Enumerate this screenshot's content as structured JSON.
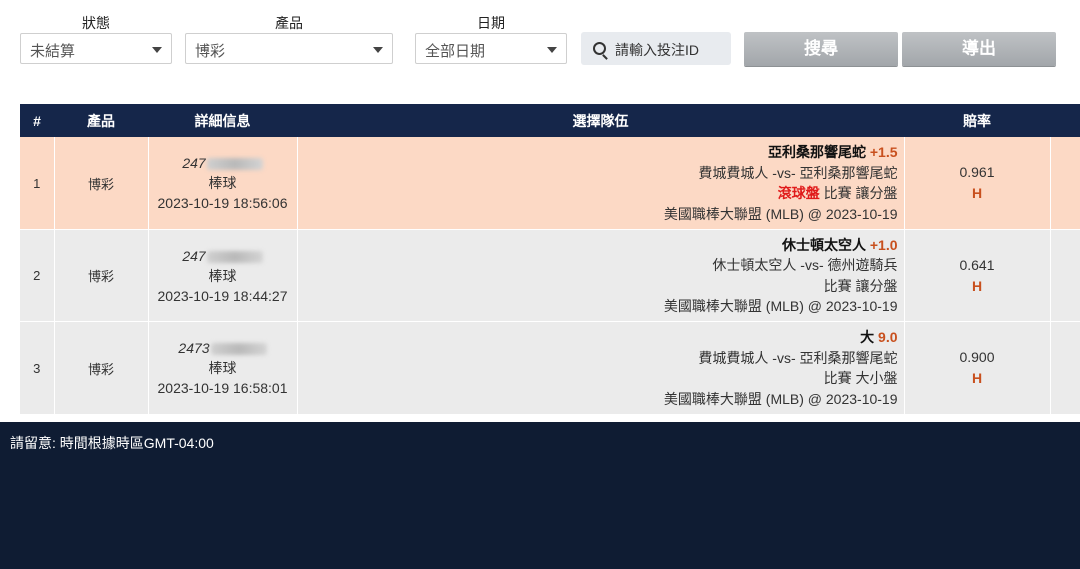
{
  "filters": {
    "status": {
      "label": "狀態",
      "value": "未結算"
    },
    "product": {
      "label": "產品",
      "value": "博彩"
    },
    "date": {
      "label": "日期",
      "value": "全部日期"
    },
    "search_placeholder": "請輸入投注ID",
    "search_button": "搜尋",
    "export_button": "導出"
  },
  "table": {
    "headers": {
      "num": "#",
      "product": "產品",
      "detail": "詳細信息",
      "selection": "選擇隊伍",
      "odds": "賠率"
    },
    "rows": [
      {
        "num": "1",
        "product": "博彩",
        "id_prefix": "247",
        "sport": "棒球",
        "datetime": "2023-10-19 18:56:06",
        "team": "亞利桑那響尾蛇",
        "handicap": "+1.5",
        "match": "費城費城人 -vs- 亞利桑那響尾蛇",
        "bet_live": "滾球盤",
        "bet_type": "比賽 讓分盤",
        "league": "美國職棒大聯盟 (MLB) @ 2023-10-19",
        "odds": "0.961",
        "odds_type": "H"
      },
      {
        "num": "2",
        "product": "博彩",
        "id_prefix": "247",
        "sport": "棒球",
        "datetime": "2023-10-19 18:44:27",
        "team": "休士頓太空人",
        "handicap": "+1.0",
        "match": "休士頓太空人 -vs- 德州遊騎兵",
        "bet_live": "",
        "bet_type": "比賽 讓分盤",
        "league": "美國職棒大聯盟 (MLB) @ 2023-10-19",
        "odds": "0.641",
        "odds_type": "H"
      },
      {
        "num": "3",
        "product": "博彩",
        "id_prefix": "2473",
        "sport": "棒球",
        "datetime": "2023-10-19 16:58:01",
        "team": "大",
        "handicap": "9.0",
        "match": "費城費城人 -vs- 亞利桑那響尾蛇",
        "bet_live": "",
        "bet_type": "比賽 大小盤",
        "league": "美國職棒大聯盟 (MLB) @ 2023-10-19",
        "odds": "0.900",
        "odds_type": "H"
      }
    ]
  },
  "note": "請留意: 時間根據時區GMT-04:00"
}
